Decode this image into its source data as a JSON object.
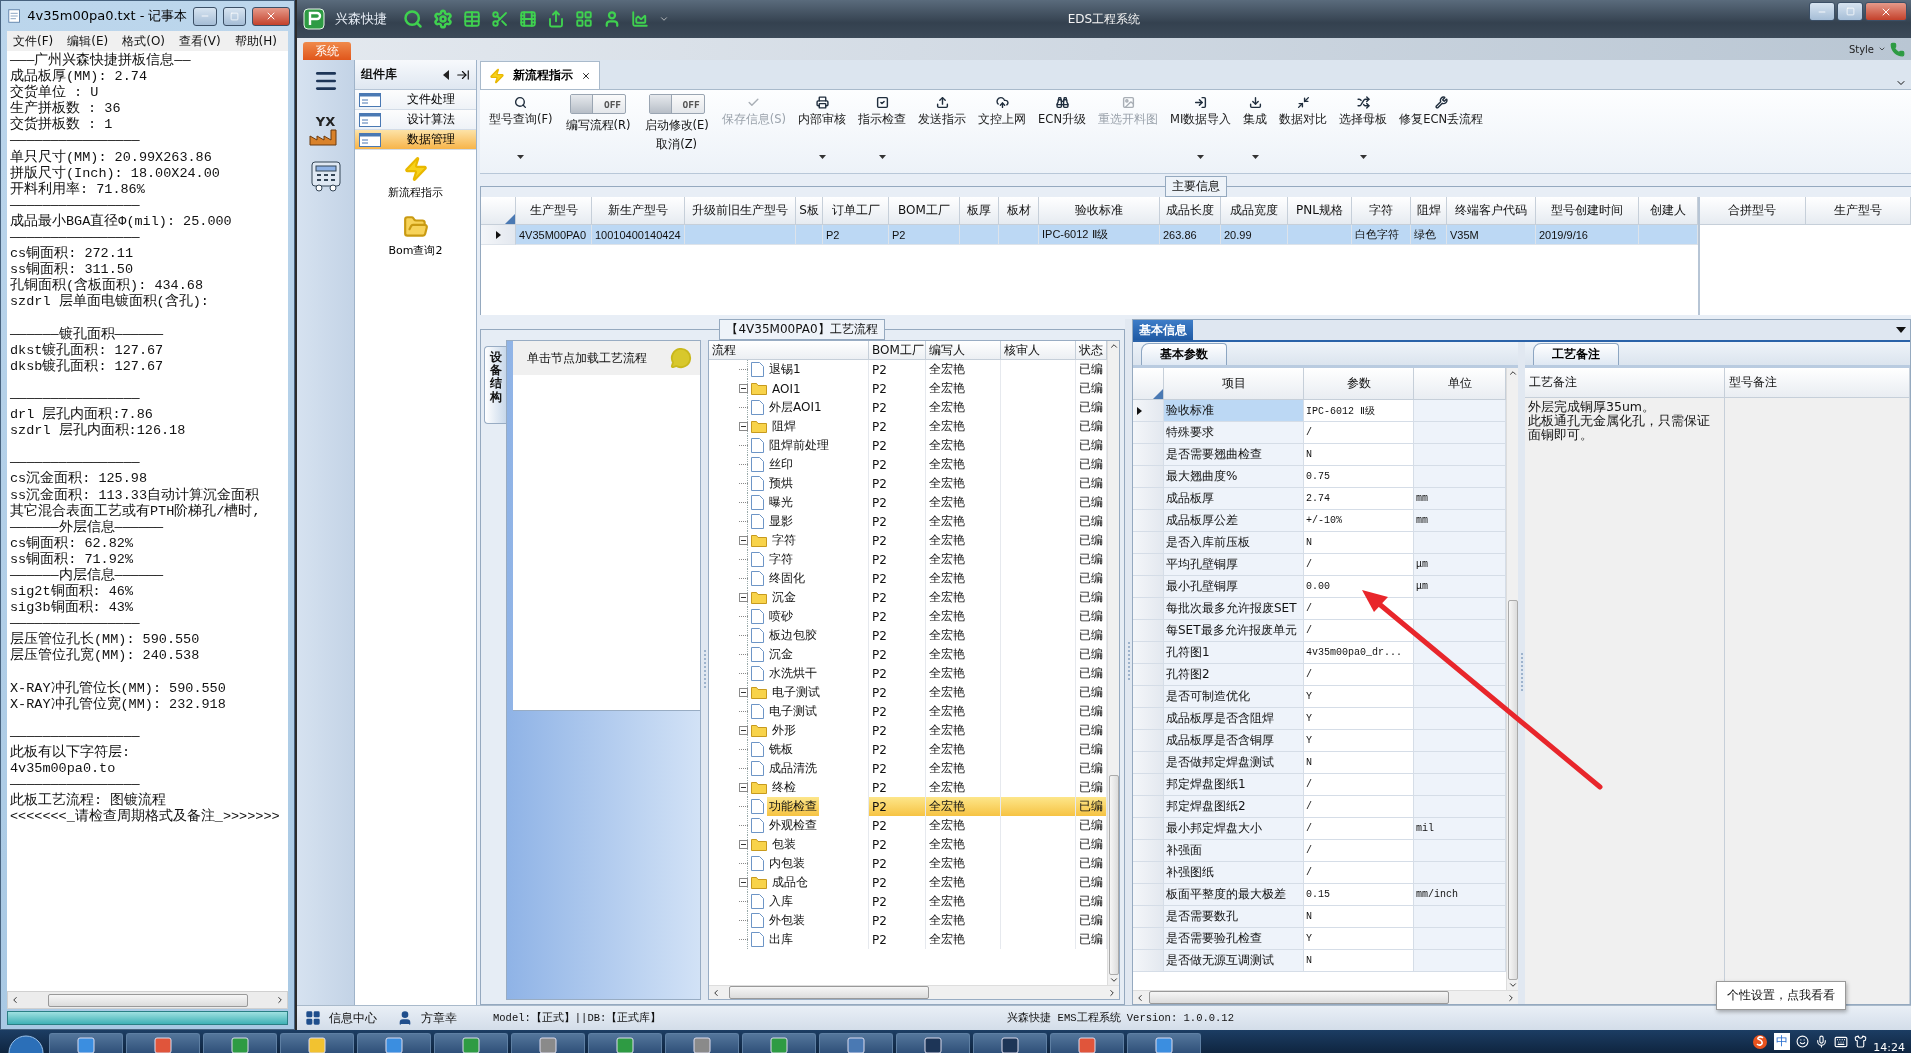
{
  "notepad": {
    "title": "4v35m00pa0.txt - 记事本",
    "menu": [
      "文件(F)",
      "编辑(E)",
      "格式(O)",
      "查看(V)",
      "帮助(H)"
    ],
    "blocks": [
      [
        "———广州兴森快捷拼板信息——",
        "成品板厚(MM): 2.74",
        "交货单位 : U",
        "生产拼板数 : 36",
        "交货拼板数 : 1",
        "————————————————",
        "单只尺寸(MM): 20.99X263.86",
        "拼版尺寸(Inch): 18.00X24.00",
        "开料利用率: 71.86%",
        "————————————————",
        "成品最小BGA直径Φ(mil):  25.000",
        "————————————————",
        "cs铜面积: 272.11",
        "ss铜面积: 311.50",
        "孔铜面积(含板面积): 434.68",
        "szdrl      层单面电镀面积(含孔):"
      ],
      [
        "——————镀孔面积——————",
        "dkst镀孔面积: 127.67",
        "dksb镀孔面积: 127.67"
      ],
      [
        "————————————————",
        "drl        层孔内面积:7.86",
        "szdrl      层孔内面积:126.18"
      ],
      [
        "————————————————",
        "cs沉金面积: 125.98",
        "ss沉金面积: 113.33自动计算沉金面积",
        "其它混合表面工艺或有PTH阶梯孔/槽时,",
        "——————外层信息——————",
        "cs铜面积: 62.82%",
        "ss铜面积: 71.92%",
        "——————内层信息——————",
        "sig2t铜面积: 46%",
        "sig3b铜面积: 43%",
        "————————————————",
        "层压管位孔长(MM): 590.550",
        "层压管位孔宽(MM): 240.538"
      ],
      [
        "X-RAY冲孔管位长(MM): 590.550",
        "X-RAY冲孔管位宽(MM): 232.918"
      ],
      [
        "————————————————",
        "此板有以下字符层:",
        "4v35m00pa0.to",
        "————————————————",
        "此板工艺流程: 图镀流程",
        "<<<<<<<_请检查周期格式及备注_>>>>>>>"
      ]
    ]
  },
  "window": {
    "brand": "兴森快捷",
    "title": "EDS工程系统",
    "system_tab": "系统",
    "style_label": "Style",
    "rail_logo": "YX"
  },
  "library": {
    "title": "组件库",
    "items": [
      {
        "label": "文件处理",
        "selected": false
      },
      {
        "label": "设计算法",
        "selected": false
      },
      {
        "label": "数据管理",
        "selected": true
      }
    ],
    "launchers": [
      "新流程指示",
      "Bom查询2"
    ]
  },
  "tabs": [
    {
      "label": "新流程指示",
      "selected": true
    }
  ],
  "toolbar": [
    {
      "kind": "button",
      "label": "型号查询(F)",
      "dropdown": true,
      "disabled": false
    },
    {
      "kind": "toggle",
      "on": false,
      "state_text": "OFF",
      "label": "编写流程(R)"
    },
    {
      "kind": "toggle",
      "on": false,
      "state_text": "OFF",
      "label": "启动修改(E)",
      "label_2": "取消(Z)"
    },
    {
      "kind": "button",
      "label": "保存信息(S)",
      "dropdown": false,
      "disabled": true
    },
    {
      "kind": "button",
      "label": "内部审核",
      "dropdown": true,
      "disabled": false
    },
    {
      "kind": "button",
      "label": "指示检查",
      "dropdown": true,
      "disabled": false
    },
    {
      "kind": "button",
      "label": "发送指示",
      "dropdown": false,
      "disabled": false
    },
    {
      "kind": "button",
      "label": "文控上网",
      "dropdown": false,
      "disabled": false
    },
    {
      "kind": "button",
      "label": "ECN升级",
      "dropdown": false,
      "disabled": false
    },
    {
      "kind": "button",
      "label": "重选开料图",
      "dropdown": false,
      "disabled": true
    },
    {
      "kind": "button",
      "label": "MI数据导入",
      "dropdown": true,
      "disabled": false
    },
    {
      "kind": "button",
      "label": "集成",
      "dropdown": true,
      "disabled": false
    },
    {
      "kind": "button",
      "label": "数据对比",
      "dropdown": false,
      "disabled": false
    },
    {
      "kind": "button",
      "label": "选择母板",
      "dropdown": true,
      "disabled": false
    },
    {
      "kind": "button",
      "label": "修复ECN丢流程",
      "dropdown": false,
      "disabled": false
    }
  ],
  "main_info": {
    "title": "主要信息",
    "columns": [
      "生产型号",
      "新生产型号",
      "升级前旧生产型号",
      "S板",
      "订单工厂",
      "BOM工厂",
      "板厚",
      "板材",
      "验收标准",
      "成品长度",
      "成品宽度",
      "PNL规格",
      "字符",
      "阻焊",
      "终端客户代码",
      "型号创建时间",
      "创建人"
    ],
    "rows": [
      {
        "selected": true,
        "cells": [
          "4V35M00PA0",
          "10010400140424",
          null,
          null,
          "P2",
          "P2",
          null,
          null,
          "IPC-6012 Ⅱ级",
          "263.86",
          "20.99",
          null,
          "白色字符",
          "绿色",
          "V35M",
          "2019/9/16",
          null
        ]
      }
    ],
    "side_columns": [
      "合拼型号",
      "生产型号"
    ]
  },
  "process": {
    "title": "【4V35M00PA0】工艺流程",
    "side_tab": "设备结构",
    "hint": "单击节点加载工艺流程",
    "columns": [
      "流程",
      "BOM工厂",
      "编写人",
      "核审人",
      "状态"
    ],
    "tree": [
      {
        "children": [
          {
            "label": "退锡1",
            "bom": "P2",
            "writer": "全宏艳",
            "status": "已编",
            "selected": false
          }
        ]
      },
      {
        "label": "AOI1",
        "bom": "P2",
        "writer": "全宏艳",
        "status": "已编",
        "selected": false,
        "expanded": true,
        "children": [
          {
            "label": "外层AOI1",
            "bom": "P2",
            "writer": "全宏艳",
            "status": "已编",
            "selected": false
          }
        ]
      },
      {
        "label": "阻焊",
        "bom": "P2",
        "writer": "全宏艳",
        "status": "已编",
        "selected": false,
        "expanded": true,
        "children": [
          {
            "label": "阻焊前处理",
            "bom": "P2",
            "writer": "全宏艳",
            "status": "已编",
            "selected": false
          },
          {
            "label": "丝印",
            "bom": "P2",
            "writer": "全宏艳",
            "status": "已编",
            "selected": false
          },
          {
            "label": "预烘",
            "bom": "P2",
            "writer": "全宏艳",
            "status": "已编",
            "selected": false
          },
          {
            "label": "曝光",
            "bom": "P2",
            "writer": "全宏艳",
            "status": "已编",
            "selected": false
          },
          {
            "label": "显影",
            "bom": "P2",
            "writer": "全宏艳",
            "status": "已编",
            "selected": false
          }
        ]
      },
      {
        "label": "字符",
        "bom": "P2",
        "writer": "全宏艳",
        "status": "已编",
        "selected": false,
        "expanded": true,
        "children": [
          {
            "label": "字符",
            "bom": "P2",
            "writer": "全宏艳",
            "status": "已编",
            "selected": false
          },
          {
            "label": "终固化",
            "bom": "P2",
            "writer": "全宏艳",
            "status": "已编",
            "selected": false
          }
        ]
      },
      {
        "label": "沉金",
        "bom": "P2",
        "writer": "全宏艳",
        "status": "已编",
        "selected": false,
        "expanded": true,
        "children": [
          {
            "label": "喷砂",
            "bom": "P2",
            "writer": "全宏艳",
            "status": "已编",
            "selected": false
          },
          {
            "label": "板边包胶",
            "bom": "P2",
            "writer": "全宏艳",
            "status": "已编",
            "selected": false
          },
          {
            "label": "沉金",
            "bom": "P2",
            "writer": "全宏艳",
            "status": "已编",
            "selected": false
          },
          {
            "label": "水洗烘干",
            "bom": "P2",
            "writer": "全宏艳",
            "status": "已编",
            "selected": false
          }
        ]
      },
      {
        "label": "电子测试",
        "bom": "P2",
        "writer": "全宏艳",
        "status": "已编",
        "selected": false,
        "expanded": true,
        "children": [
          {
            "label": "电子测试",
            "bom": "P2",
            "writer": "全宏艳",
            "status": "已编",
            "selected": false
          }
        ]
      },
      {
        "label": "外形",
        "bom": "P2",
        "writer": "全宏艳",
        "status": "已编",
        "selected": false,
        "expanded": true,
        "children": [
          {
            "label": "铣板",
            "bom": "P2",
            "writer": "全宏艳",
            "status": "已编",
            "selected": false
          },
          {
            "label": "成品清洗",
            "bom": "P2",
            "writer": "全宏艳",
            "status": "已编",
            "selected": false
          }
        ]
      },
      {
        "label": "终检",
        "bom": "P2",
        "writer": "全宏艳",
        "status": "已编",
        "selected": false,
        "expanded": true,
        "children": [
          {
            "label": "功能检查",
            "bom": "P2",
            "writer": "全宏艳",
            "status": "已编",
            "selected": true
          },
          {
            "label": "外观检查",
            "bom": "P2",
            "writer": "全宏艳",
            "status": "已编",
            "selected": false
          }
        ]
      },
      {
        "label": "包装",
        "bom": "P2",
        "writer": "全宏艳",
        "status": "已编",
        "selected": false,
        "expanded": true,
        "children": [
          {
            "label": "内包装",
            "bom": "P2",
            "writer": "全宏艳",
            "status": "已编",
            "selected": false
          }
        ]
      },
      {
        "label": "成品仓",
        "bom": "P2",
        "writer": "全宏艳",
        "status": "已编",
        "selected": false,
        "expanded": true,
        "children": [
          {
            "label": "入库",
            "bom": "P2",
            "writer": "全宏艳",
            "status": "已编",
            "selected": false
          },
          {
            "label": "外包装",
            "bom": "P2",
            "writer": "全宏艳",
            "status": "已编",
            "selected": false
          },
          {
            "label": "出库",
            "bom": "P2",
            "writer": "全宏艳",
            "status": "已编",
            "selected": false
          }
        ]
      }
    ]
  },
  "basic_info": {
    "title": "基本信息",
    "tab": "基本参数",
    "columns": [
      "项目",
      "参数",
      "单位"
    ],
    "rows": [
      {
        "item": "验收标准",
        "value": "IPC-6012 Ⅱ级",
        "selected": true
      },
      {
        "item": "特殊要求",
        "value": "/",
        "selected": false
      },
      {
        "item": "是否需要翘曲检查",
        "value": "N",
        "selected": false
      },
      {
        "item": "最大翘曲度%",
        "value": "0.75",
        "selected": false
      },
      {
        "item": "成品板厚",
        "value": "2.74",
        "unit": "mm",
        "selected": false
      },
      {
        "item": "成品板厚公差",
        "value": "+/-10%",
        "unit": "mm",
        "selected": false
      },
      {
        "item": "是否入库前压板",
        "value": "N",
        "selected": false
      },
      {
        "item": "平均孔壁铜厚",
        "value": "/",
        "unit": "μm",
        "selected": false
      },
      {
        "item": "最小孔壁铜厚",
        "value": "0.00",
        "unit": "μm",
        "selected": false
      },
      {
        "item": "每批次最多允许报废SET",
        "value": "/",
        "selected": false
      },
      {
        "item": "每SET最多允许报废单元",
        "value": "/",
        "selected": false
      },
      {
        "item": "孔符图1",
        "value": "4v35m00pa0_dr...",
        "selected": false
      },
      {
        "item": "孔符图2",
        "value": "/",
        "selected": false
      },
      {
        "item": "是否可制造优化",
        "value": "Y",
        "selected": false
      },
      {
        "item": "成品板厚是否含阻焊",
        "value": "Y",
        "selected": false
      },
      {
        "item": "成品板厚是否含铜厚",
        "value": "Y",
        "selected": false
      },
      {
        "item": "是否做邦定焊盘测试",
        "value": "N",
        "selected": false
      },
      {
        "item": "邦定焊盘图纸1",
        "value": "/",
        "selected": false
      },
      {
        "item": "邦定焊盘图纸2",
        "value": "/",
        "selected": false
      },
      {
        "item": "最小邦定焊盘大小",
        "value": "/",
        "unit": "mil",
        "selected": false
      },
      {
        "item": "补强面",
        "value": "/",
        "selected": false
      },
      {
        "item": "补强图纸",
        "value": "/",
        "selected": false
      },
      {
        "item": "板面平整度的最大极差",
        "value": "0.15",
        "unit": "mm/inch",
        "selected": false
      },
      {
        "item": "是否需要数孔",
        "value": "N",
        "selected": false
      },
      {
        "item": "是否需要验孔检查",
        "value": "Y",
        "selected": false
      },
      {
        "item": "是否做无源互调测试",
        "value": "N",
        "selected": false
      }
    ]
  },
  "remarks": {
    "tab": "工艺备注",
    "columns": [
      "工艺备注",
      "型号备注"
    ],
    "text": [
      "外层完成铜厚35um。",
      "此板通孔无金属化孔，只需保证面铜即可。"
    ]
  },
  "tooltip": "个性设置，点我看看",
  "status_bar": {
    "info_center": "信息中心",
    "user": "方章幸",
    "model": "Model:【正式】||DB:【正式库】",
    "version": "兴森快捷 EMS工程系统 Version: 1.0.0.12"
  },
  "taskbar": {
    "ime": "中",
    "clock": "14:24"
  }
}
